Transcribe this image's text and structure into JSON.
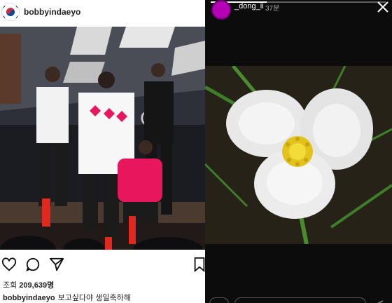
{
  "post": {
    "username": "bobbyindaeyo",
    "views_label": "조회",
    "views_count": "209,639명",
    "caption_user": "bobbyindaeyo",
    "caption_text": "보고싶다야 생일축하해"
  },
  "story": {
    "username": "_dong_ii",
    "time": "37분",
    "progress": 0.32
  },
  "icons": {
    "flag": "korea-flag-icon",
    "like": "heart-icon",
    "comment": "comment-icon",
    "share": "send-icon",
    "save": "bookmark-icon",
    "close": "close-icon"
  },
  "colors": {
    "accent_pink": "#e8175d",
    "story_ring": "#b500b5"
  }
}
